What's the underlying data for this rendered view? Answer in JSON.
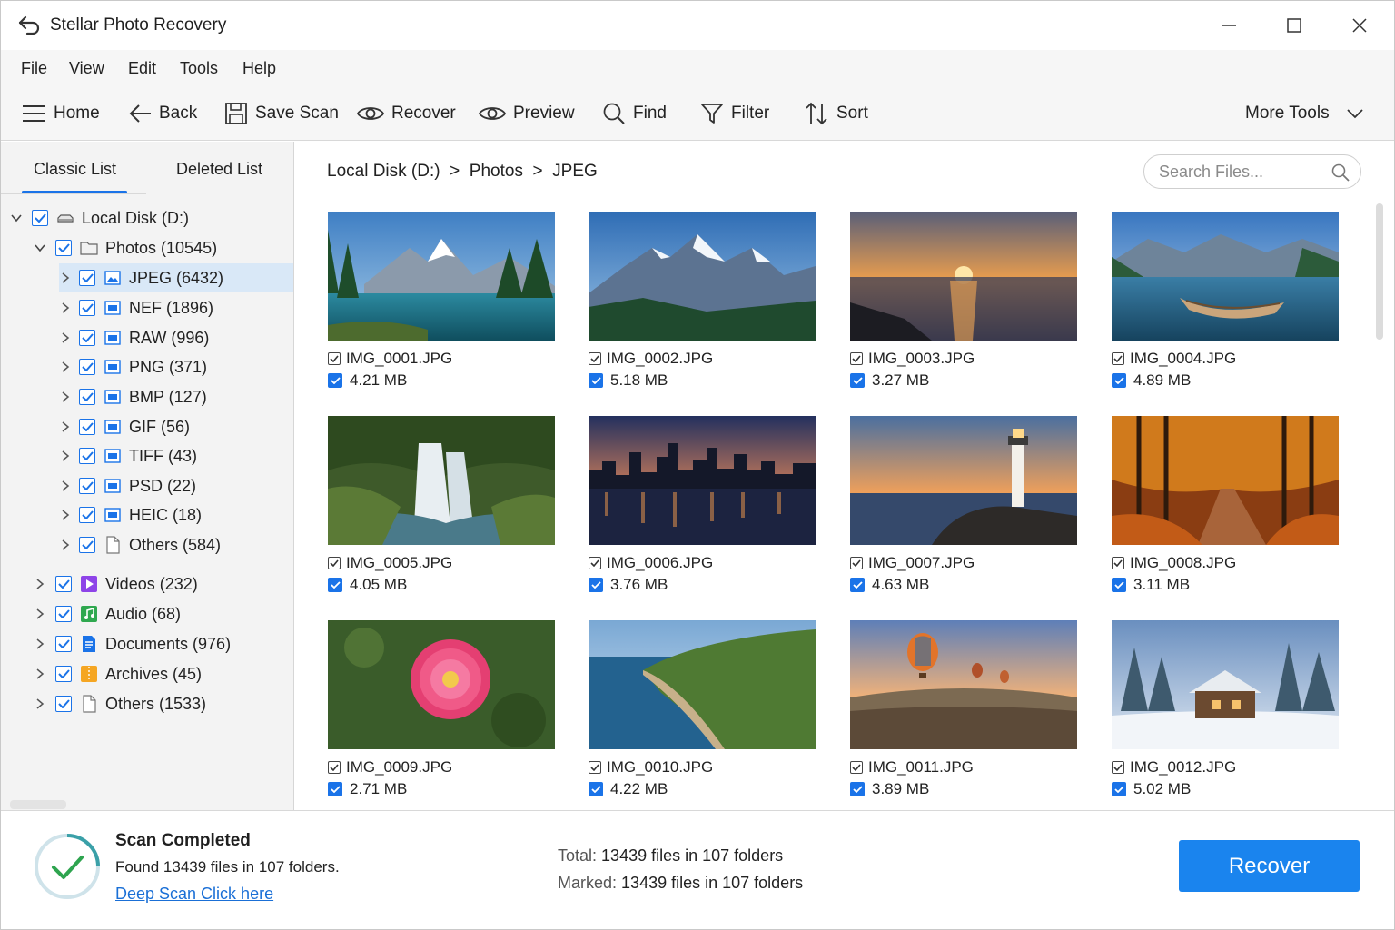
{
  "window": {
    "title": "Stellar Photo Recovery"
  },
  "menu": [
    "File",
    "View",
    "Edit",
    "Tools",
    "Help"
  ],
  "toolbar": {
    "home": "Home",
    "back": "Back",
    "save_scan": "Save Scan",
    "recover": "Recover",
    "preview": "Preview",
    "find": "Find",
    "filter": "Filter",
    "sort": "Sort",
    "more_tools": "More Tools"
  },
  "sidebar": {
    "tabs": [
      "Classic List",
      "Deleted List"
    ],
    "root": "Local Disk (D:)",
    "photos": "Photos (10545)",
    "photo_types": [
      "JPEG (6432)",
      "NEF (1896)",
      "RAW (996)",
      "PNG (371)",
      "BMP (127)",
      "GIF (56)",
      "TIFF (43)",
      "PSD (22)",
      "HEIC (18)",
      "Others (584)"
    ],
    "categories": [
      "Videos (232)",
      "Audio (68)",
      "Documents (976)",
      "Archives (45)",
      "Others (1533)"
    ]
  },
  "content": {
    "breadcrumb": "Local Disk (D:)  >  Photos  >  JPEG",
    "search_placeholder": "Search Files...",
    "files": [
      {
        "name": "IMG_0001.JPG",
        "size": "4.21 MB"
      },
      {
        "name": "IMG_0002.JPG",
        "size": "5.18 MB"
      },
      {
        "name": "IMG_0003.JPG",
        "size": "3.27 MB"
      },
      {
        "name": "IMG_0004.JPG",
        "size": "4.89 MB"
      },
      {
        "name": "IMG_0005.JPG",
        "size": "4.05 MB"
      },
      {
        "name": "IMG_0006.JPG",
        "size": "3.76 MB"
      },
      {
        "name": "IMG_0007.JPG",
        "size": "4.63 MB"
      },
      {
        "name": "IMG_0008.JPG",
        "size": "3.11 MB"
      },
      {
        "name": "IMG_0009.JPG",
        "size": "2.71 MB"
      },
      {
        "name": "IMG_0010.JPG",
        "size": "4.22 MB"
      },
      {
        "name": "IMG_0011.JPG",
        "size": "3.89 MB"
      },
      {
        "name": "IMG_0012.JPG",
        "size": "5.02 MB"
      }
    ]
  },
  "status": {
    "title": "Scan Completed",
    "subtitle": "Found 13439 files in 107 folders.",
    "link": "Deep Scan Click here",
    "total_label": "Total:",
    "total_value": "13439 files in 107 folders",
    "marked_label": "Marked:",
    "marked_value": "13439 files in 107 folders",
    "recover_button": "Recover"
  },
  "colors": {
    "accent": "#1a73e8",
    "button": "#1a84ee",
    "success": "#2ea44f",
    "selected_row": "#d9e8f7"
  }
}
